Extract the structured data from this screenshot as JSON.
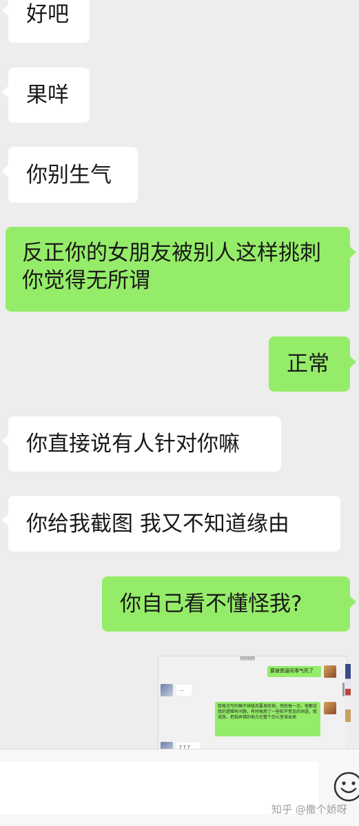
{
  "messages": [
    {
      "side": "in",
      "text": "好吧"
    },
    {
      "side": "in",
      "text": "果咩"
    },
    {
      "side": "in",
      "text": "你别生气"
    },
    {
      "side": "out",
      "text": "反正你的女朋友被别人这样挑刺你觉得无所谓"
    },
    {
      "side": "out",
      "text": "正常"
    },
    {
      "side": "in",
      "text": "你直接说有人针对你嘛"
    },
    {
      "side": "in",
      "text": "你给我截图 我又不知道缘由"
    },
    {
      "side": "out",
      "text": "你自己看不懂怪我?"
    }
  ],
  "screenshot_image": {
    "top_label": "下午4:55",
    "msg1": "要被傻逼同事气死了",
    "msg2": "...",
    "msg3": "我每次写的稿子排版后要发给他，然后每一次，他都说我的逻辑有问题，有时候用了一些较不常见的词语，就说我，把我弄错的地方在整个办公室读出来",
    "msg4": "? ? ?"
  },
  "input": {
    "value": "",
    "placeholder": ""
  },
  "icons": {
    "emoji": "emoji-smile-icon"
  },
  "watermark": "知乎 @撒个娇呀",
  "colors": {
    "background": "#ededed",
    "outgoing_bubble": "#95ec69",
    "incoming_bubble": "#ffffff"
  }
}
